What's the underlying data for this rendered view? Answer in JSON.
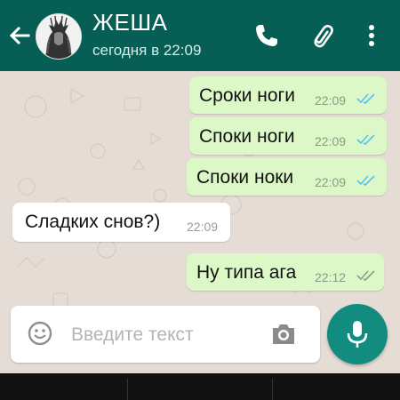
{
  "header": {
    "contact_name": "ЖЕША",
    "last_seen": "сегодня в 22:09",
    "back_icon": "arrow-left-icon",
    "call_icon": "phone-icon",
    "attach_icon": "paperclip-icon",
    "menu_icon": "more-vertical-icon"
  },
  "colors": {
    "header": "#075e54",
    "outgoing": "#dcf8c6",
    "incoming": "#ffffff",
    "read_tick": "#4fc3f7",
    "delivered_tick": "#8c9a8c",
    "mic_button": "#128c7e",
    "chat_bg": "#e5ddd5"
  },
  "messages": [
    {
      "text": "Сроки ноги",
      "time": "22:09",
      "direction": "outgoing",
      "status": "read"
    },
    {
      "text": "Споки ноги",
      "time": "22:09",
      "direction": "outgoing",
      "status": "read"
    },
    {
      "text": "Споки ноки",
      "time": "22:09",
      "direction": "outgoing",
      "status": "read"
    },
    {
      "text": "Сладких снов?)",
      "time": "22:09",
      "direction": "incoming"
    },
    {
      "text": "Ну типа ага",
      "time": "22:12",
      "direction": "outgoing",
      "status": "delivered"
    }
  ],
  "composer": {
    "placeholder": "Введите текст",
    "emoji_icon": "emoji-icon",
    "camera_icon": "camera-icon",
    "mic_icon": "microphone-icon"
  }
}
